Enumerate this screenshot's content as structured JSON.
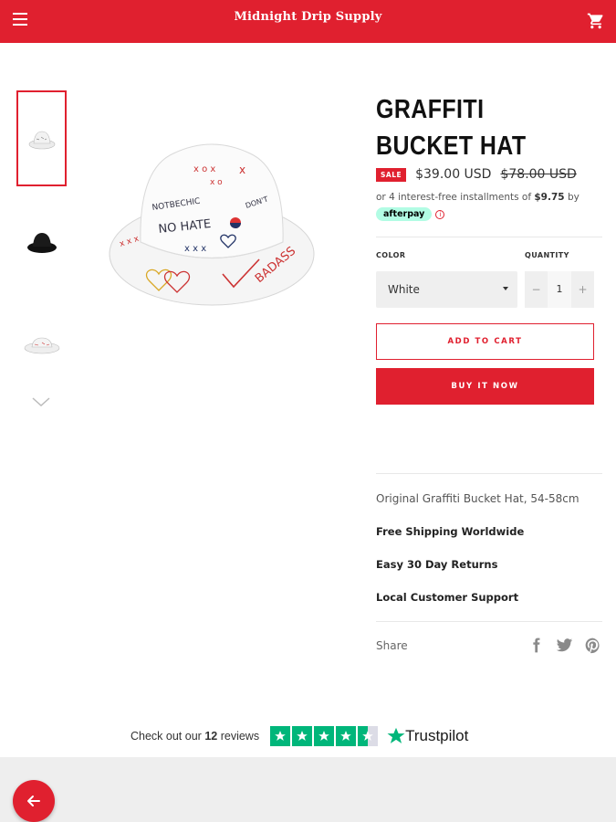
{
  "header": {
    "store_name": "Midnight Drip Supply",
    "menu_icon": "hamburger-icon",
    "cart_icon": "cart-icon",
    "brand_color": "#e0202f"
  },
  "gallery": {
    "thumbnails": [
      "white-hat",
      "black-hat",
      "white-hat-side"
    ],
    "active_index": 0
  },
  "product": {
    "title": "GRAFFITI BUCKET HAT",
    "sale_badge": "SALE",
    "price": "$39.00 USD",
    "compare_price": "$78.00 USD",
    "installments_prefix": "or 4 interest-free installments of",
    "installment_amount": "$9.75",
    "installments_suffix": "by",
    "afterpay_label": "afterpay",
    "color_label": "COLOR",
    "color_value": "White",
    "quantity_label": "QUANTITY",
    "quantity_minus": "−",
    "quantity_value": "1",
    "quantity_plus": "+",
    "add_to_cart": "ADD TO CART",
    "buy_now": "BUY IT NOW",
    "description": "Original Graffiti Bucket Hat, 54-58cm",
    "features": [
      "Free Shipping Worldwide",
      "Easy 30 Day Returns",
      "Local Customer Support"
    ],
    "share_label": "Share"
  },
  "trustpilot": {
    "text_prefix": "Check out our",
    "review_count": "12",
    "text_suffix": "reviews",
    "stars": 4.5,
    "logo_text": "Trustpilot",
    "color": "#00b67a"
  },
  "back_button_icon": "arrow-left-icon"
}
